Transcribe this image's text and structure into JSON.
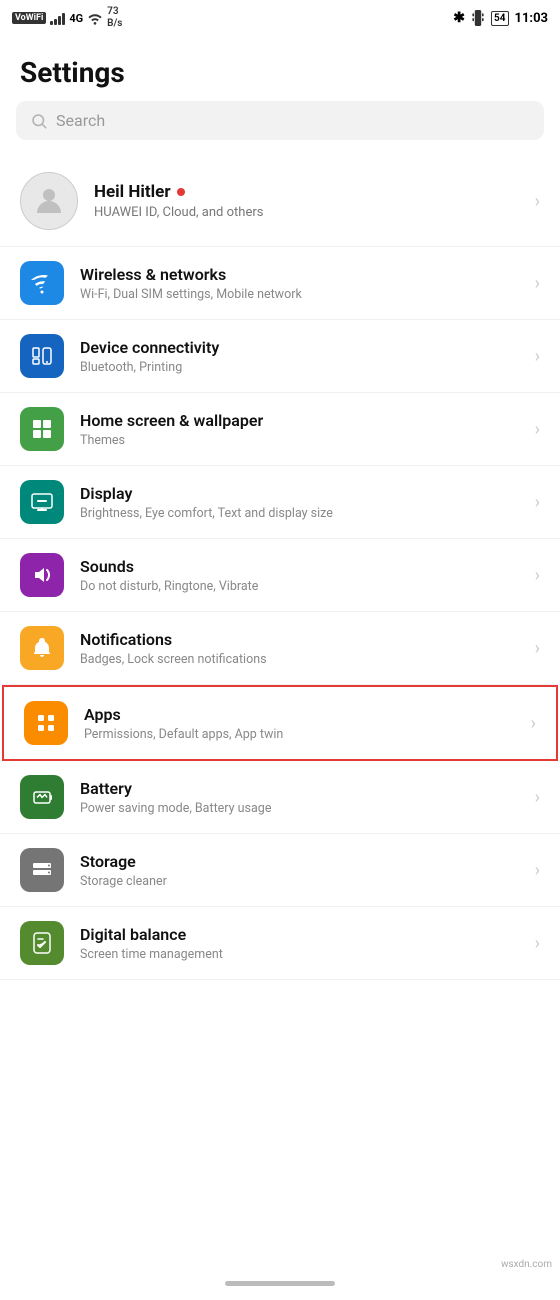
{
  "statusBar": {
    "left": {
      "vowifi": "VoWiFi",
      "signal": "4G",
      "speed": "73\nB/s"
    },
    "right": {
      "bluetooth": "✱",
      "battery": "54",
      "time": "11:03"
    }
  },
  "page": {
    "title": "Settings"
  },
  "search": {
    "placeholder": "Search"
  },
  "profile": {
    "name": "Heil Hitler",
    "subtitle": "HUAWEI ID, Cloud, and others"
  },
  "settingsItems": [
    {
      "id": "wireless",
      "iconColor": "icon-blue",
      "title": "Wireless & networks",
      "subtitle": "Wi-Fi, Dual SIM settings, Mobile network",
      "highlighted": false
    },
    {
      "id": "device-connectivity",
      "iconColor": "icon-blue-dark",
      "title": "Device connectivity",
      "subtitle": "Bluetooth, Printing",
      "highlighted": false
    },
    {
      "id": "home-screen",
      "iconColor": "icon-green",
      "title": "Home screen & wallpaper",
      "subtitle": "Themes",
      "highlighted": false
    },
    {
      "id": "display",
      "iconColor": "icon-teal",
      "title": "Display",
      "subtitle": "Brightness, Eye comfort, Text and display size",
      "highlighted": false
    },
    {
      "id": "sounds",
      "iconColor": "icon-purple",
      "title": "Sounds",
      "subtitle": "Do not disturb, Ringtone, Vibrate",
      "highlighted": false
    },
    {
      "id": "notifications",
      "iconColor": "icon-yellow",
      "title": "Notifications",
      "subtitle": "Badges, Lock screen notifications",
      "highlighted": false
    },
    {
      "id": "apps",
      "iconColor": "icon-orange",
      "title": "Apps",
      "subtitle": "Permissions, Default apps, App twin",
      "highlighted": true
    },
    {
      "id": "battery",
      "iconColor": "icon-green-battery",
      "title": "Battery",
      "subtitle": "Power saving mode, Battery usage",
      "highlighted": false
    },
    {
      "id": "storage",
      "iconColor": "icon-gray",
      "title": "Storage",
      "subtitle": "Storage cleaner",
      "highlighted": false
    },
    {
      "id": "digital-balance",
      "iconColor": "icon-green-balance",
      "title": "Digital balance",
      "subtitle": "Screen time management",
      "highlighted": false
    }
  ],
  "watermark": "wsxdn.com"
}
